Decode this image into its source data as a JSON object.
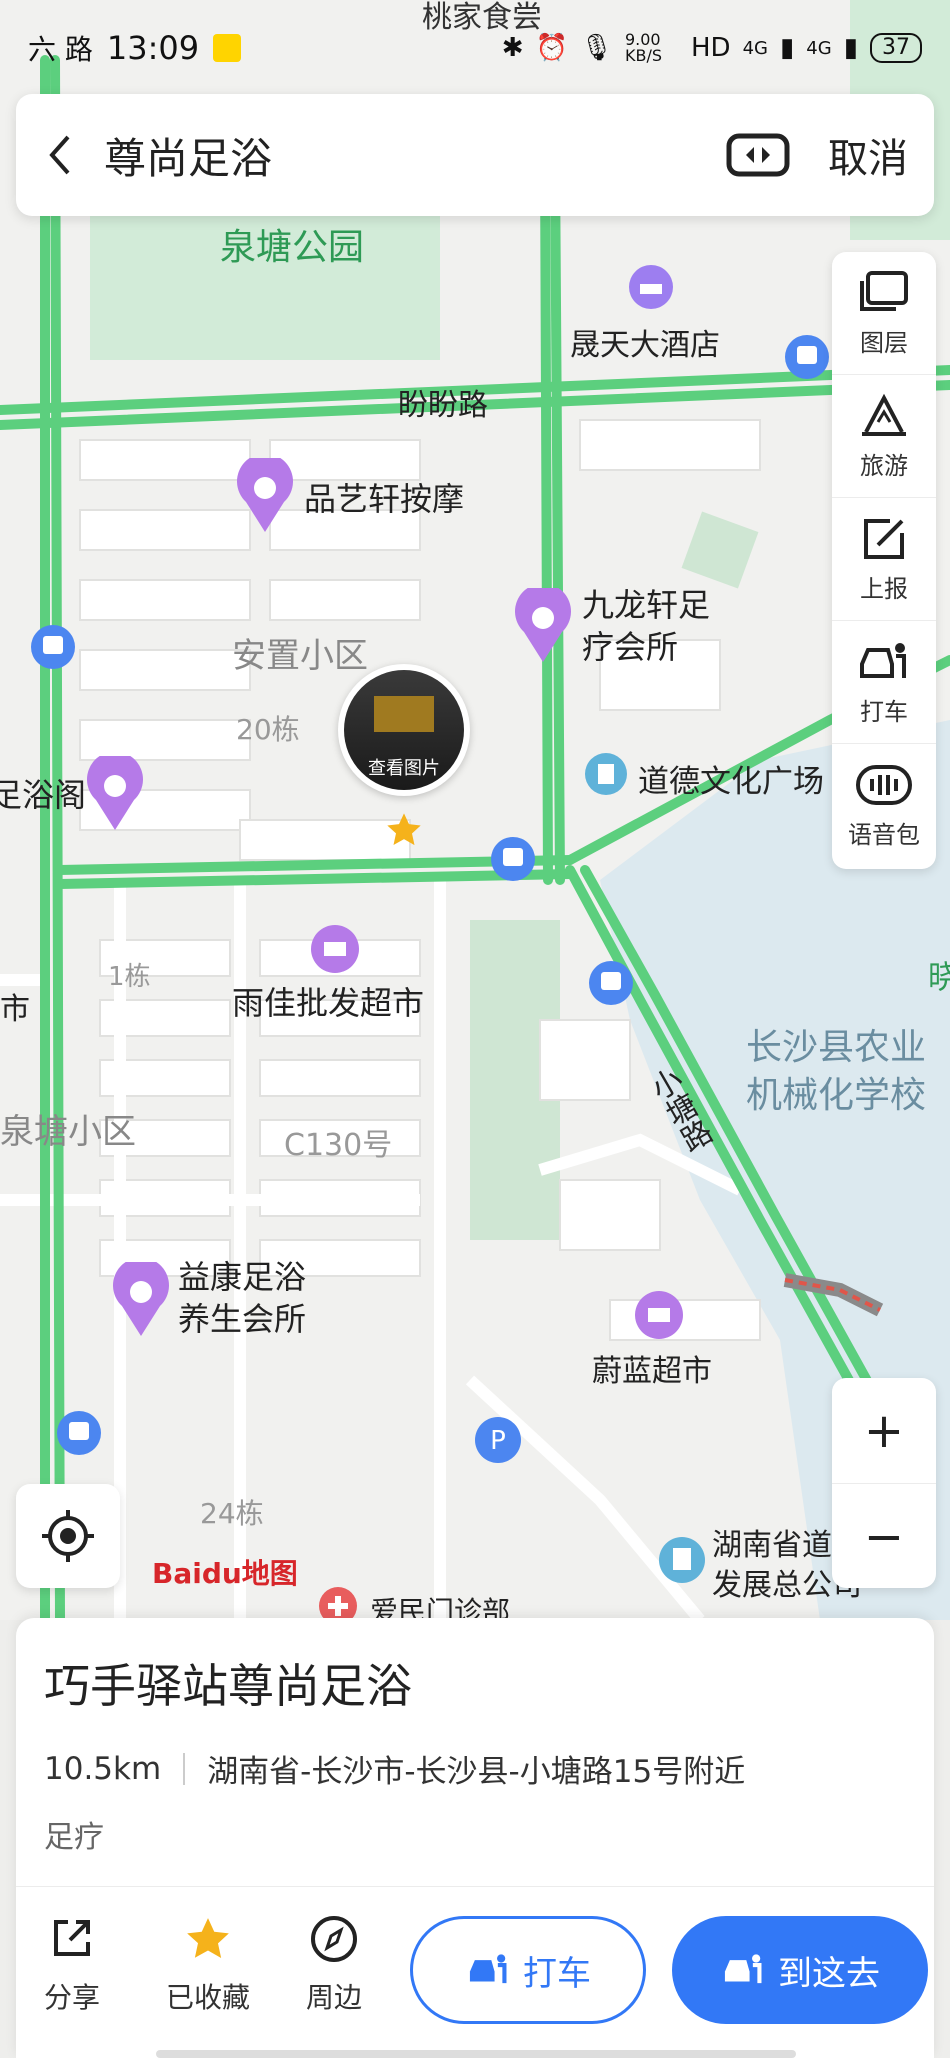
{
  "status_bar": {
    "left_text": "六 路",
    "time": "13:09",
    "network_speed": "9.00 KB/S",
    "hd": "HD",
    "signal": "4G",
    "battery": "37"
  },
  "search": {
    "query": "尊尚足浴",
    "cancel_label": "取消"
  },
  "map": {
    "labels": {
      "top_partial": "桃家食尝",
      "quantang_park": "泉塘公园",
      "shengtian_hotel": "晟天大酒店",
      "panpan_road": "盼盼路",
      "pinyixuan": "品艺轩按摩",
      "jiulongxuan_1": "九龙轩足",
      "jiulongxuan_2": "疗会所",
      "anzhi": "安置小区",
      "bldg20": "20栋",
      "photo_label": "查看图片",
      "daode": "道德文化广场",
      "left_yuge": "足浴阁",
      "bldg1": "1栋",
      "left_shi": "市",
      "yujia": "雨佳批发超市",
      "quantang_xq": "泉塘小区",
      "c130": "C130号",
      "xiaotang_road": "小塘路",
      "school_1": "长沙县农业",
      "school_2": "机械化学校",
      "right_xiao": "晓",
      "yikang_1": "益康足浴",
      "yikang_2": "养生会所",
      "weilan": "蔚蓝超市",
      "bldg24": "24栋",
      "hunan_1": "湖南省道",
      "hunan_2": "发展总公司",
      "clinic": "爱民门诊部",
      "logo": "Baidu地图"
    }
  },
  "side_tools": [
    {
      "label": "图层",
      "icon": "layers-icon"
    },
    {
      "label": "旅游",
      "icon": "travel-icon"
    },
    {
      "label": "上报",
      "icon": "report-icon"
    },
    {
      "label": "打车",
      "icon": "taxi-icon"
    },
    {
      "label": "语音包",
      "icon": "voice-pack-icon"
    }
  ],
  "zoom": {
    "in": "+",
    "out": "−"
  },
  "poi": {
    "name": "巧手驿站尊尚足浴",
    "distance": "10.5km",
    "address": "湖南省-长沙市-长沙县-小塘路15号附近",
    "category": "足疗"
  },
  "actions": {
    "share": "分享",
    "favorited": "已收藏",
    "nearby": "周边",
    "taxi": "打车",
    "go_here": "到这去"
  },
  "colors": {
    "road_green": "#5ccf7e",
    "accent_blue": "#3278f6",
    "poi_purple": "#b57ae8",
    "water": "#d4e6f0",
    "park": "#cfe9d5"
  }
}
